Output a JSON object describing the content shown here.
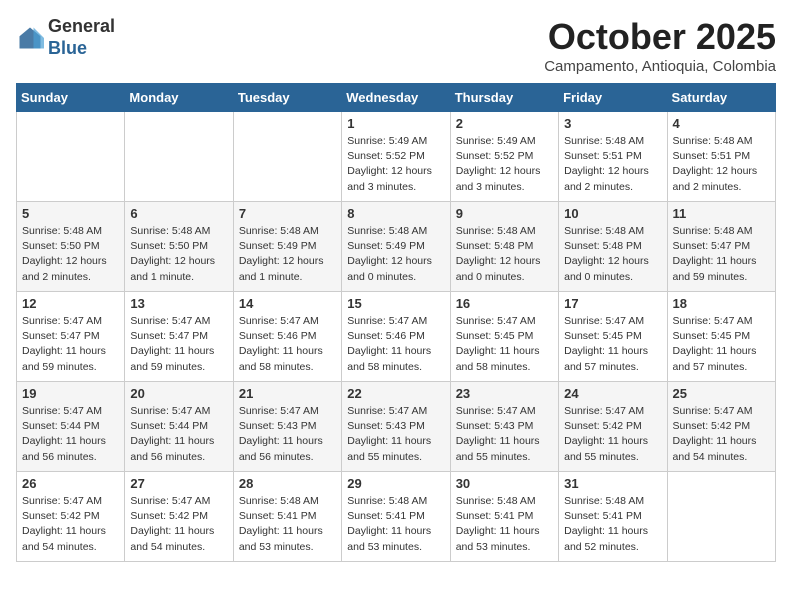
{
  "header": {
    "logo_general": "General",
    "logo_blue": "Blue",
    "month_title": "October 2025",
    "location": "Campamento, Antioquia, Colombia"
  },
  "days_of_week": [
    "Sunday",
    "Monday",
    "Tuesday",
    "Wednesday",
    "Thursday",
    "Friday",
    "Saturday"
  ],
  "weeks": [
    [
      {
        "day": "",
        "info": ""
      },
      {
        "day": "",
        "info": ""
      },
      {
        "day": "",
        "info": ""
      },
      {
        "day": "1",
        "info": "Sunrise: 5:49 AM\nSunset: 5:52 PM\nDaylight: 12 hours\nand 3 minutes."
      },
      {
        "day": "2",
        "info": "Sunrise: 5:49 AM\nSunset: 5:52 PM\nDaylight: 12 hours\nand 3 minutes."
      },
      {
        "day": "3",
        "info": "Sunrise: 5:48 AM\nSunset: 5:51 PM\nDaylight: 12 hours\nand 2 minutes."
      },
      {
        "day": "4",
        "info": "Sunrise: 5:48 AM\nSunset: 5:51 PM\nDaylight: 12 hours\nand 2 minutes."
      }
    ],
    [
      {
        "day": "5",
        "info": "Sunrise: 5:48 AM\nSunset: 5:50 PM\nDaylight: 12 hours\nand 2 minutes."
      },
      {
        "day": "6",
        "info": "Sunrise: 5:48 AM\nSunset: 5:50 PM\nDaylight: 12 hours\nand 1 minute."
      },
      {
        "day": "7",
        "info": "Sunrise: 5:48 AM\nSunset: 5:49 PM\nDaylight: 12 hours\nand 1 minute."
      },
      {
        "day": "8",
        "info": "Sunrise: 5:48 AM\nSunset: 5:49 PM\nDaylight: 12 hours\nand 0 minutes."
      },
      {
        "day": "9",
        "info": "Sunrise: 5:48 AM\nSunset: 5:48 PM\nDaylight: 12 hours\nand 0 minutes."
      },
      {
        "day": "10",
        "info": "Sunrise: 5:48 AM\nSunset: 5:48 PM\nDaylight: 12 hours\nand 0 minutes."
      },
      {
        "day": "11",
        "info": "Sunrise: 5:48 AM\nSunset: 5:47 PM\nDaylight: 11 hours\nand 59 minutes."
      }
    ],
    [
      {
        "day": "12",
        "info": "Sunrise: 5:47 AM\nSunset: 5:47 PM\nDaylight: 11 hours\nand 59 minutes."
      },
      {
        "day": "13",
        "info": "Sunrise: 5:47 AM\nSunset: 5:47 PM\nDaylight: 11 hours\nand 59 minutes."
      },
      {
        "day": "14",
        "info": "Sunrise: 5:47 AM\nSunset: 5:46 PM\nDaylight: 11 hours\nand 58 minutes."
      },
      {
        "day": "15",
        "info": "Sunrise: 5:47 AM\nSunset: 5:46 PM\nDaylight: 11 hours\nand 58 minutes."
      },
      {
        "day": "16",
        "info": "Sunrise: 5:47 AM\nSunset: 5:45 PM\nDaylight: 11 hours\nand 58 minutes."
      },
      {
        "day": "17",
        "info": "Sunrise: 5:47 AM\nSunset: 5:45 PM\nDaylight: 11 hours\nand 57 minutes."
      },
      {
        "day": "18",
        "info": "Sunrise: 5:47 AM\nSunset: 5:45 PM\nDaylight: 11 hours\nand 57 minutes."
      }
    ],
    [
      {
        "day": "19",
        "info": "Sunrise: 5:47 AM\nSunset: 5:44 PM\nDaylight: 11 hours\nand 56 minutes."
      },
      {
        "day": "20",
        "info": "Sunrise: 5:47 AM\nSunset: 5:44 PM\nDaylight: 11 hours\nand 56 minutes."
      },
      {
        "day": "21",
        "info": "Sunrise: 5:47 AM\nSunset: 5:43 PM\nDaylight: 11 hours\nand 56 minutes."
      },
      {
        "day": "22",
        "info": "Sunrise: 5:47 AM\nSunset: 5:43 PM\nDaylight: 11 hours\nand 55 minutes."
      },
      {
        "day": "23",
        "info": "Sunrise: 5:47 AM\nSunset: 5:43 PM\nDaylight: 11 hours\nand 55 minutes."
      },
      {
        "day": "24",
        "info": "Sunrise: 5:47 AM\nSunset: 5:42 PM\nDaylight: 11 hours\nand 55 minutes."
      },
      {
        "day": "25",
        "info": "Sunrise: 5:47 AM\nSunset: 5:42 PM\nDaylight: 11 hours\nand 54 minutes."
      }
    ],
    [
      {
        "day": "26",
        "info": "Sunrise: 5:47 AM\nSunset: 5:42 PM\nDaylight: 11 hours\nand 54 minutes."
      },
      {
        "day": "27",
        "info": "Sunrise: 5:47 AM\nSunset: 5:42 PM\nDaylight: 11 hours\nand 54 minutes."
      },
      {
        "day": "28",
        "info": "Sunrise: 5:48 AM\nSunset: 5:41 PM\nDaylight: 11 hours\nand 53 minutes."
      },
      {
        "day": "29",
        "info": "Sunrise: 5:48 AM\nSunset: 5:41 PM\nDaylight: 11 hours\nand 53 minutes."
      },
      {
        "day": "30",
        "info": "Sunrise: 5:48 AM\nSunset: 5:41 PM\nDaylight: 11 hours\nand 53 minutes."
      },
      {
        "day": "31",
        "info": "Sunrise: 5:48 AM\nSunset: 5:41 PM\nDaylight: 11 hours\nand 52 minutes."
      },
      {
        "day": "",
        "info": ""
      }
    ]
  ]
}
